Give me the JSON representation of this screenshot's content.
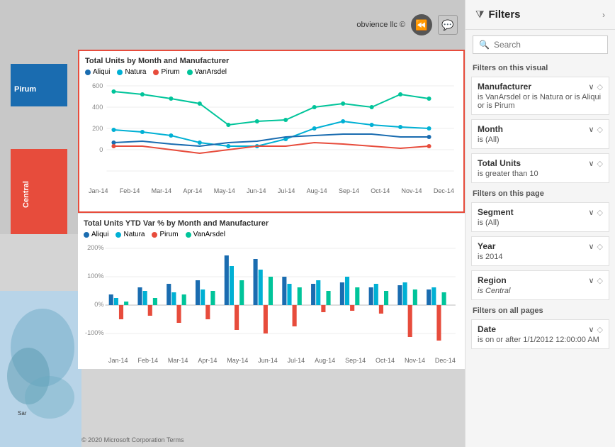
{
  "header": {
    "logo_text": "obvience llc ©"
  },
  "left": {
    "side_bars": [
      {
        "label": "Pirum",
        "color": "#1a6cb0"
      },
      {
        "label": "Central",
        "color": "#e74c3c"
      }
    ],
    "chart1": {
      "title": "Total Units by Month and Manufacturer",
      "legend": [
        {
          "label": "Aliqui",
          "color": "#1a6cb0"
        },
        {
          "label": "Natura",
          "color": "#00b0d4"
        },
        {
          "label": "Pirum",
          "color": "#e74c3c"
        },
        {
          "label": "VanArsdel",
          "color": "#00c49a"
        }
      ],
      "x_labels": [
        "Jan-14",
        "Feb-14",
        "Mar-14",
        "Apr-14",
        "May-14",
        "Jun-14",
        "Jul-14",
        "Aug-14",
        "Sep-14",
        "Oct-14",
        "Nov-14",
        "Dec-14"
      ]
    },
    "chart2": {
      "title": "Total Units YTD Var % by Month and Manufacturer",
      "legend": [
        {
          "label": "Aliqui",
          "color": "#1a6cb0"
        },
        {
          "label": "Natura",
          "color": "#00b0d4"
        },
        {
          "label": "Pirum",
          "color": "#e74c3c"
        },
        {
          "label": "VanArsdel",
          "color": "#00c49a"
        }
      ],
      "x_labels": [
        "Jan-14",
        "Feb-14",
        "Mar-14",
        "Apr-14",
        "May-14",
        "Jun-14",
        "Jul-14",
        "Aug-14",
        "Sep-14",
        "Oct-14",
        "Nov-14",
        "Dec-14"
      ],
      "y_labels": [
        "200%",
        "100%",
        "0%",
        "-100%"
      ]
    }
  },
  "filters": {
    "title": "Filters",
    "search_placeholder": "Search",
    "section_visual": "Filters on this visual",
    "section_page": "Filters on this page",
    "section_all": "Filters on all pages",
    "visual_filters": [
      {
        "title": "Manufacturer",
        "subtitle": "is VanArsdel or is Natura or is Aliqui or is Pirum"
      },
      {
        "title": "Month",
        "subtitle": "is (All)"
      },
      {
        "title": "Total Units",
        "subtitle": "is greater than 10"
      }
    ],
    "page_filters": [
      {
        "title": "Segment",
        "subtitle": "is (All)"
      },
      {
        "title": "Year",
        "subtitle": "is 2014"
      },
      {
        "title": "Region",
        "subtitle": "is Central",
        "italic": true
      }
    ],
    "all_filters": [
      {
        "title": "Date",
        "subtitle": "is on or after 1/1/2012 12:00:00 AM"
      }
    ]
  },
  "footer": {
    "text": "© 2020 Microsoft Corporation  Terms"
  }
}
